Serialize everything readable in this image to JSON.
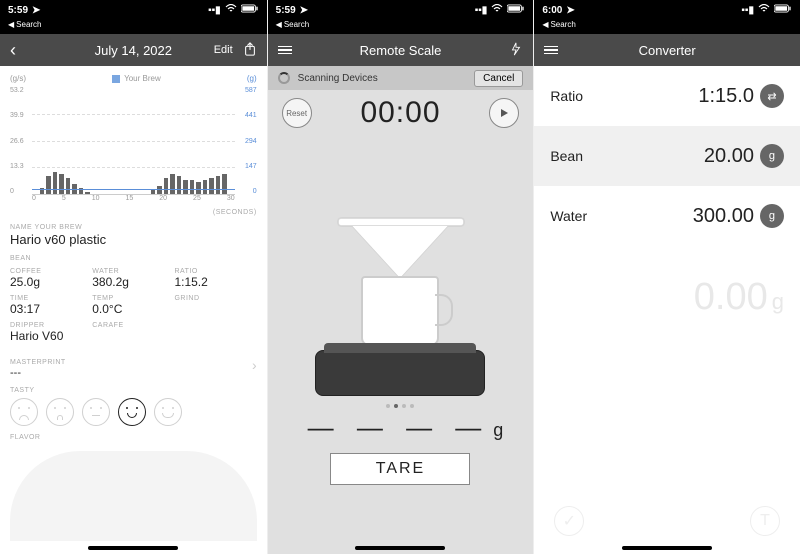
{
  "statusbar": {
    "time1": "5:59",
    "time2": "5:59",
    "time3": "6:00",
    "back_label": "Search"
  },
  "screen1": {
    "nav": {
      "title": "July 14, 2022",
      "edit": "Edit"
    },
    "legend": {
      "yunit": "(g/s)",
      "series": "Your Brew",
      "yunit2": "(g)"
    },
    "chart_yticks": [
      "53.2",
      "39.9",
      "26.6",
      "13.3",
      "0"
    ],
    "chart_y2ticks": [
      "587",
      "441",
      "294",
      "147",
      "0"
    ],
    "chart_xticks": [
      "0",
      "5",
      "10",
      "15",
      "20",
      "25",
      "30"
    ],
    "chart_xlabel": "(seconds)",
    "name_label": "NAME YOUR BREW",
    "name_value": "Hario v60 plastic",
    "bean_label": "BEAN",
    "stats": {
      "coffee_l": "COFFEE",
      "coffee_v": "25.0g",
      "water_l": "WATER",
      "water_v": "380.2g",
      "ratio_l": "RATIO",
      "ratio_v": "1:15.2",
      "time_l": "TIME",
      "time_v": "03:17",
      "temp_l": "TEMP",
      "temp_v": "0.0°C",
      "grind_l": "GRIND",
      "dripper_l": "DRIPPER",
      "dripper_v": "Hario V60",
      "carafe_l": "CARAFE"
    },
    "master_l": "MASTERPRINT",
    "master_v": "---",
    "tasty_l": "TASTY",
    "flavor_l": "FLAVOR"
  },
  "screen2": {
    "nav_title": "Remote Scale",
    "scan_label": "Scanning Devices",
    "cancel": "Cancel",
    "reset": "Reset",
    "timer": "00:00",
    "weight": "— — — —",
    "unit": "g",
    "tare": "TARE"
  },
  "screen3": {
    "nav_title": "Converter",
    "ratio_l": "Ratio",
    "ratio_v": "1:15.0",
    "bean_l": "Bean",
    "bean_v": "20.00",
    "bean_u": "g",
    "water_l": "Water",
    "water_v": "300.00",
    "water_u": "g",
    "result_v": "0.00",
    "result_u": "g"
  },
  "chart_data": {
    "type": "bar",
    "title": "Your Brew",
    "xlabel": "seconds",
    "ylabel_left": "g/s",
    "ylabel_right": "g",
    "x": [
      0,
      1,
      2,
      3,
      4,
      5,
      6,
      7,
      8,
      9,
      10,
      11,
      12,
      13,
      14,
      15,
      16,
      17,
      18,
      19,
      20,
      21,
      22,
      23,
      24,
      25,
      26,
      27,
      28,
      29,
      30
    ],
    "flow_gps": [
      0,
      3,
      9,
      11,
      10,
      8,
      5,
      3,
      1,
      0,
      0,
      0,
      0,
      0,
      0,
      0,
      0,
      0,
      2,
      4,
      8,
      10,
      9,
      7,
      7,
      6,
      7,
      8,
      9,
      10,
      0
    ],
    "ylim_left": [
      0,
      53.2
    ],
    "ylim_right": [
      0,
      587
    ],
    "xlim": [
      0,
      30
    ]
  }
}
